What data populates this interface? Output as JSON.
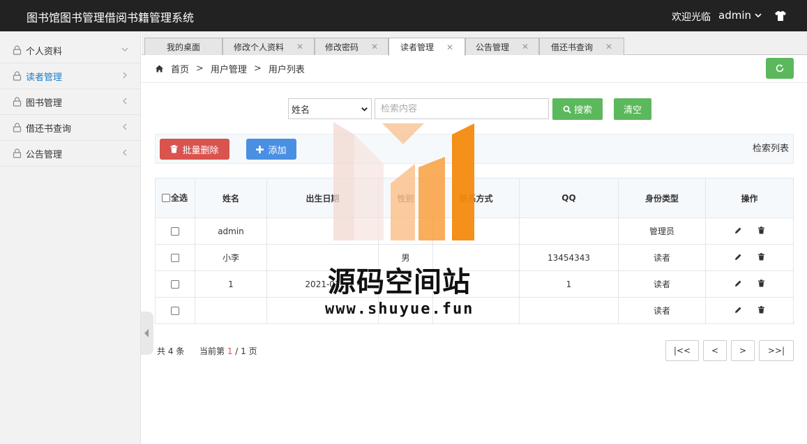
{
  "app": {
    "title": "图书馆图书管理借阅书籍管理系统",
    "welcome": "欢迎光临",
    "username": "admin"
  },
  "sidebar": {
    "items": [
      {
        "label": "个人资料",
        "active": false
      },
      {
        "label": "读者管理",
        "active": true
      },
      {
        "label": "图书管理",
        "active": false
      },
      {
        "label": "借还书查询",
        "active": false
      },
      {
        "label": "公告管理",
        "active": false
      }
    ]
  },
  "tabs": [
    {
      "label": "我的桌面",
      "closable": false,
      "active": false
    },
    {
      "label": "修改个人资料",
      "closable": true,
      "active": false
    },
    {
      "label": "修改密码",
      "closable": true,
      "active": false
    },
    {
      "label": "读者管理",
      "closable": true,
      "active": true
    },
    {
      "label": "公告管理",
      "closable": true,
      "active": false
    },
    {
      "label": "借还书查询",
      "closable": true,
      "active": false
    }
  ],
  "breadcrumb": [
    "首页",
    "用户管理",
    "用户列表"
  ],
  "search": {
    "field": "姓名",
    "placeholder": "检索内容",
    "search_label": "搜索",
    "clear_label": "清空"
  },
  "toolbar": {
    "batch_delete_label": "批量删除",
    "add_label": "添加",
    "list_label": "检索列表"
  },
  "table": {
    "select_all_label": "全选",
    "columns": [
      "姓名",
      "出生日期",
      "性别",
      "联系方式",
      "QQ",
      "身份类型",
      "操作"
    ],
    "rows": [
      {
        "name": "admin",
        "birth": "",
        "gender": "",
        "contact": "",
        "qq": "",
        "role": "管理员"
      },
      {
        "name": "小李",
        "birth": "",
        "gender": "男",
        "contact": "",
        "qq": "13454343",
        "role": "读者"
      },
      {
        "name": "1",
        "birth": "2021-01",
        "gender": "",
        "contact": "",
        "qq": "1",
        "role": "读者"
      },
      {
        "name": "",
        "birth": "",
        "gender": "",
        "contact": "",
        "qq": "",
        "role": "读者"
      }
    ]
  },
  "pager": {
    "total_prefix": "共",
    "total": "4",
    "total_suffix": "条",
    "current_prefix": "当前第",
    "current": "1",
    "pages": "/ 1 页",
    "first": "|<<",
    "prev": "<",
    "next": ">",
    "last": ">>|"
  },
  "watermark": {
    "text": "源码空间站",
    "url": "www.shuyue.fun"
  },
  "colors": {
    "header_bg": "#222222",
    "sidebar_active": "#1b7ec7",
    "success": "#5cb85c",
    "danger": "#d9534f",
    "primary": "#4a90e2"
  }
}
